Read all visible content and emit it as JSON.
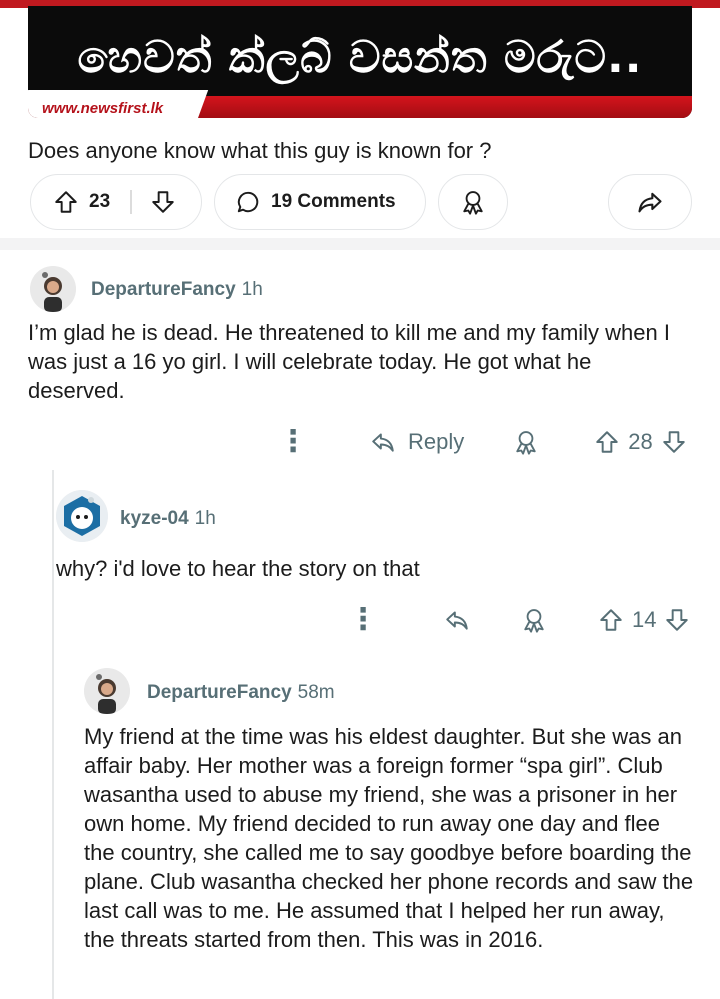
{
  "post": {
    "banner_title": "හෙවත් ක්ලබ් වසන්ත මරුට..",
    "banner_url": "www.newsfirst.lk",
    "title": "Does anyone know what this guy is known for ?",
    "upvotes": "23",
    "comments_label": "19 Comments"
  },
  "comments": [
    {
      "username": "DepartureFancy",
      "time": "1h",
      "body": "I’m glad he is dead. He threatened to kill me and my family when I was just a 16 yo girl. I will celebrate today. He got what he deserved.",
      "reply_label": "Reply",
      "votes": "28"
    },
    {
      "username": "kyze-04",
      "time": "1h",
      "body": "why? i'd love to hear the story on that",
      "votes": "14"
    },
    {
      "username": "DepartureFancy",
      "time": "58m",
      "body": "My friend at the time was his eldest daughter. But she was an affair baby. Her mother was a foreign former “spa girl”. Club wasantha used to abuse my friend, she was a prisoner in her own home. My friend decided to run away one day and flee the country, she called me to say goodbye before boarding the plane. Club wasantha checked her phone records and saw the last call was to me. He assumed that I helped her run away, the threats started from then. This was in 2016."
    }
  ],
  "icons": {
    "upvote": "upvote-arrow-icon",
    "downvote": "downvote-arrow-icon",
    "comment": "speech-bubble-icon",
    "award": "award-icon",
    "share": "share-arrow-icon",
    "reply": "reply-arrow-icon",
    "more": "more-dots-icon"
  },
  "colors": {
    "banner_red": "#c0191f",
    "meta_gray": "#576f76",
    "text": "#1c1c1c"
  }
}
